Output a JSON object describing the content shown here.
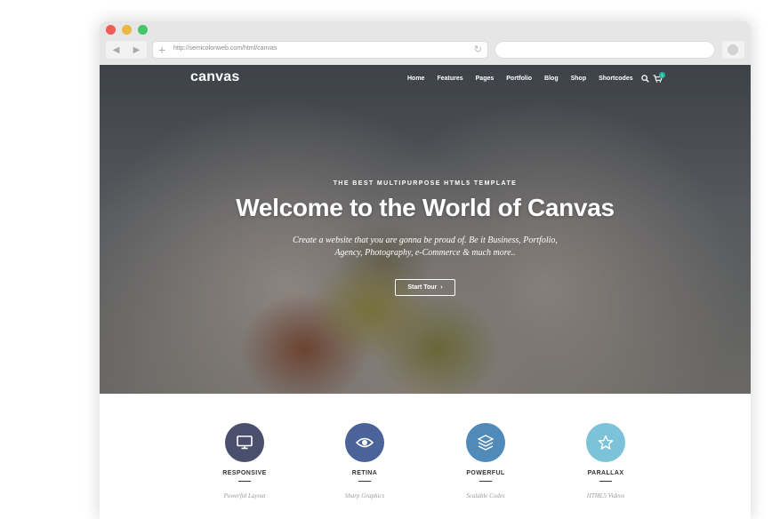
{
  "browser": {
    "url": "http://semicolonweb.com/html/canvas",
    "back_icon": "◀",
    "forward_icon": "▶",
    "plus_icon": "+",
    "reload_icon": "↻",
    "traffic_colors": [
      "#ee5a55",
      "#e8b83f",
      "#47c467"
    ]
  },
  "site": {
    "logo": "canvas",
    "nav": [
      "Home",
      "Features",
      "Pages",
      "Portfolio",
      "Blog",
      "Shop",
      "Shortcodes"
    ],
    "cart_count": "1",
    "accent_color": "#1abc9c"
  },
  "hero": {
    "kicker": "THE BEST MULTIPURPOSE HTML5 TEMPLATE",
    "headline": "Welcome to the World of Canvas",
    "sub_line1": "Create a website that you are gonna be proud of. Be it Business, Portfolio,",
    "sub_line2": "Agency, Photography, e-Commerce & much more..",
    "cta_label": "Start Tour",
    "cta_icon": "›"
  },
  "features": [
    {
      "title": "RESPONSIVE",
      "subtitle": "Powerful Layout",
      "color": "#4a4f6d",
      "icon": "monitor-icon"
    },
    {
      "title": "RETINA",
      "subtitle": "Sharp Graphics",
      "color": "#4a6399",
      "icon": "eye-icon"
    },
    {
      "title": "POWERFUL",
      "subtitle": "Scalable Codes",
      "color": "#4f8ab8",
      "icon": "layers-icon"
    },
    {
      "title": "PARALLAX",
      "subtitle": "HTML5 Videos",
      "color": "#7cc3d9",
      "icon": "star-icon"
    }
  ]
}
